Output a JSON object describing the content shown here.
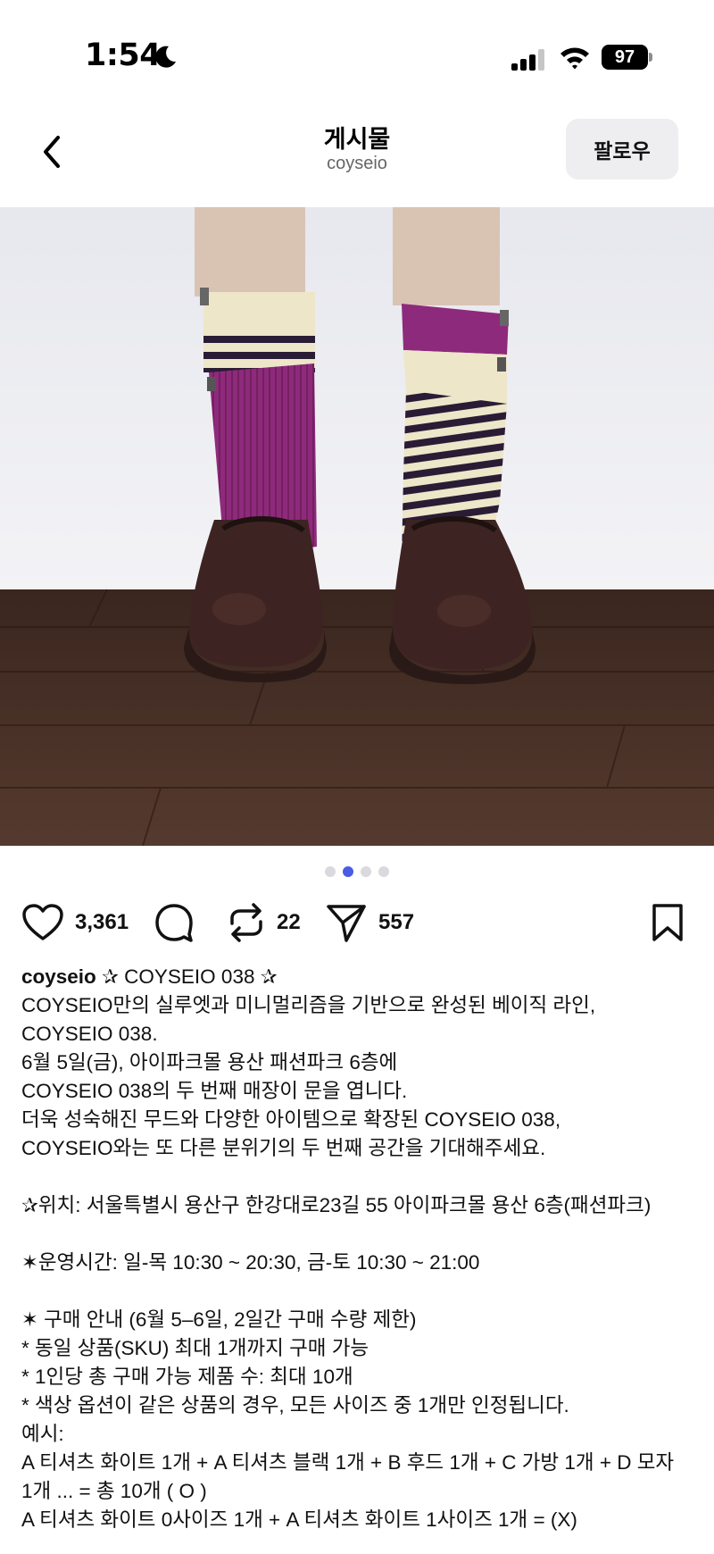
{
  "status_bar": {
    "time": "1:54",
    "battery": "97"
  },
  "header": {
    "title": "게시물",
    "subtitle": "coyseio",
    "follow_label": "팔로우"
  },
  "carousel": {
    "total": 4,
    "active_index": 1
  },
  "actions": {
    "likes": "3,361",
    "reposts": "22",
    "shares": "557"
  },
  "caption": {
    "username": "coyseio",
    "first_line_rest": " ✰ COYSEIO 038 ✰",
    "lines": [
      "COYSEIO만의 실루엣과 미니멀리즘을 기반으로 완성된 베이직 라인,",
      "COYSEIO 038.",
      "6월 5일(금), 아이파크몰 용산 패션파크 6층에",
      "COYSEIO 038의 두 번째 매장이 문을 엽니다.",
      "더욱 성숙해진 무드와 다양한 아이템으로 확장된 COYSEIO 038,",
      "COYSEIO와는 또 다른 분위기의 두 번째 공간을 기대해주세요.",
      "",
      "✰위치: 서울특별시 용산구 한강대로23길 55 아이파크몰 용산 6층(패션파크)",
      "",
      "✶운영시간: 일-목 10:30 ~ 20:30, 금-토 10:30 ~ 21:00",
      "",
      "✶ 구매 안내 (6월 5–6일, 2일간 구매 수량 제한)",
      "* 동일 상품(SKU) 최대 1개까지 구매 가능",
      "* 1인당 총 구매 가능 제품 수: 최대 10개",
      "* 색상 옵션이 같은 상품의 경우, 모든 사이즈 중 1개만 인정됩니다.",
      "예시:",
      "A 티셔츠 화이트 1개 + A 티셔츠 블랙 1개 + B 후드 1개 + C 가방 1개 + D 모자",
      "1개 ... = 총 10개 ( O )",
      "A 티셔츠 화이트 0사이즈 1개 + A 티셔츠 화이트 1사이즈 1개 = (X)"
    ]
  },
  "colors": {
    "accent_dot": "#4a5be6",
    "follow_bg": "#eeeef0",
    "sock_purple": "#8e2a7c",
    "sock_cream": "#ede6c9",
    "stripe_dark": "#2a1c35",
    "floor": "#4a3026",
    "shoe": "#3d2422"
  }
}
